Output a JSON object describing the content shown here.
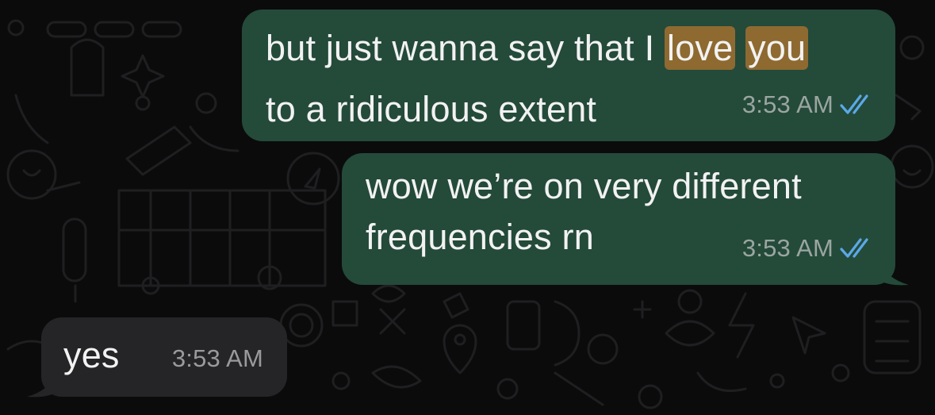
{
  "messages": [
    {
      "direction": "outgoing",
      "line1_before": "but just wanna say that I ",
      "highlight1": "love",
      "highlight2": "you",
      "line2": "to a ridiculous extent",
      "time": "3:53 AM",
      "status": "read"
    },
    {
      "direction": "outgoing",
      "line1": "wow we’re on very different",
      "line2": "frequencies rn",
      "time": "3:53 AM",
      "status": "read"
    },
    {
      "direction": "incoming",
      "text": "yes",
      "time": "3:53 AM"
    }
  ],
  "colors": {
    "background": "#0b0b0c",
    "outgoing_bubble": "#244a3a",
    "incoming_bubble": "#252527",
    "search_highlight": "#8e6a31",
    "read_ticks": "#5aa9e6",
    "timestamp": "#9aa6a0"
  },
  "icons": [
    "double-check-read-icon",
    "chat-wallpaper-doodles"
  ]
}
